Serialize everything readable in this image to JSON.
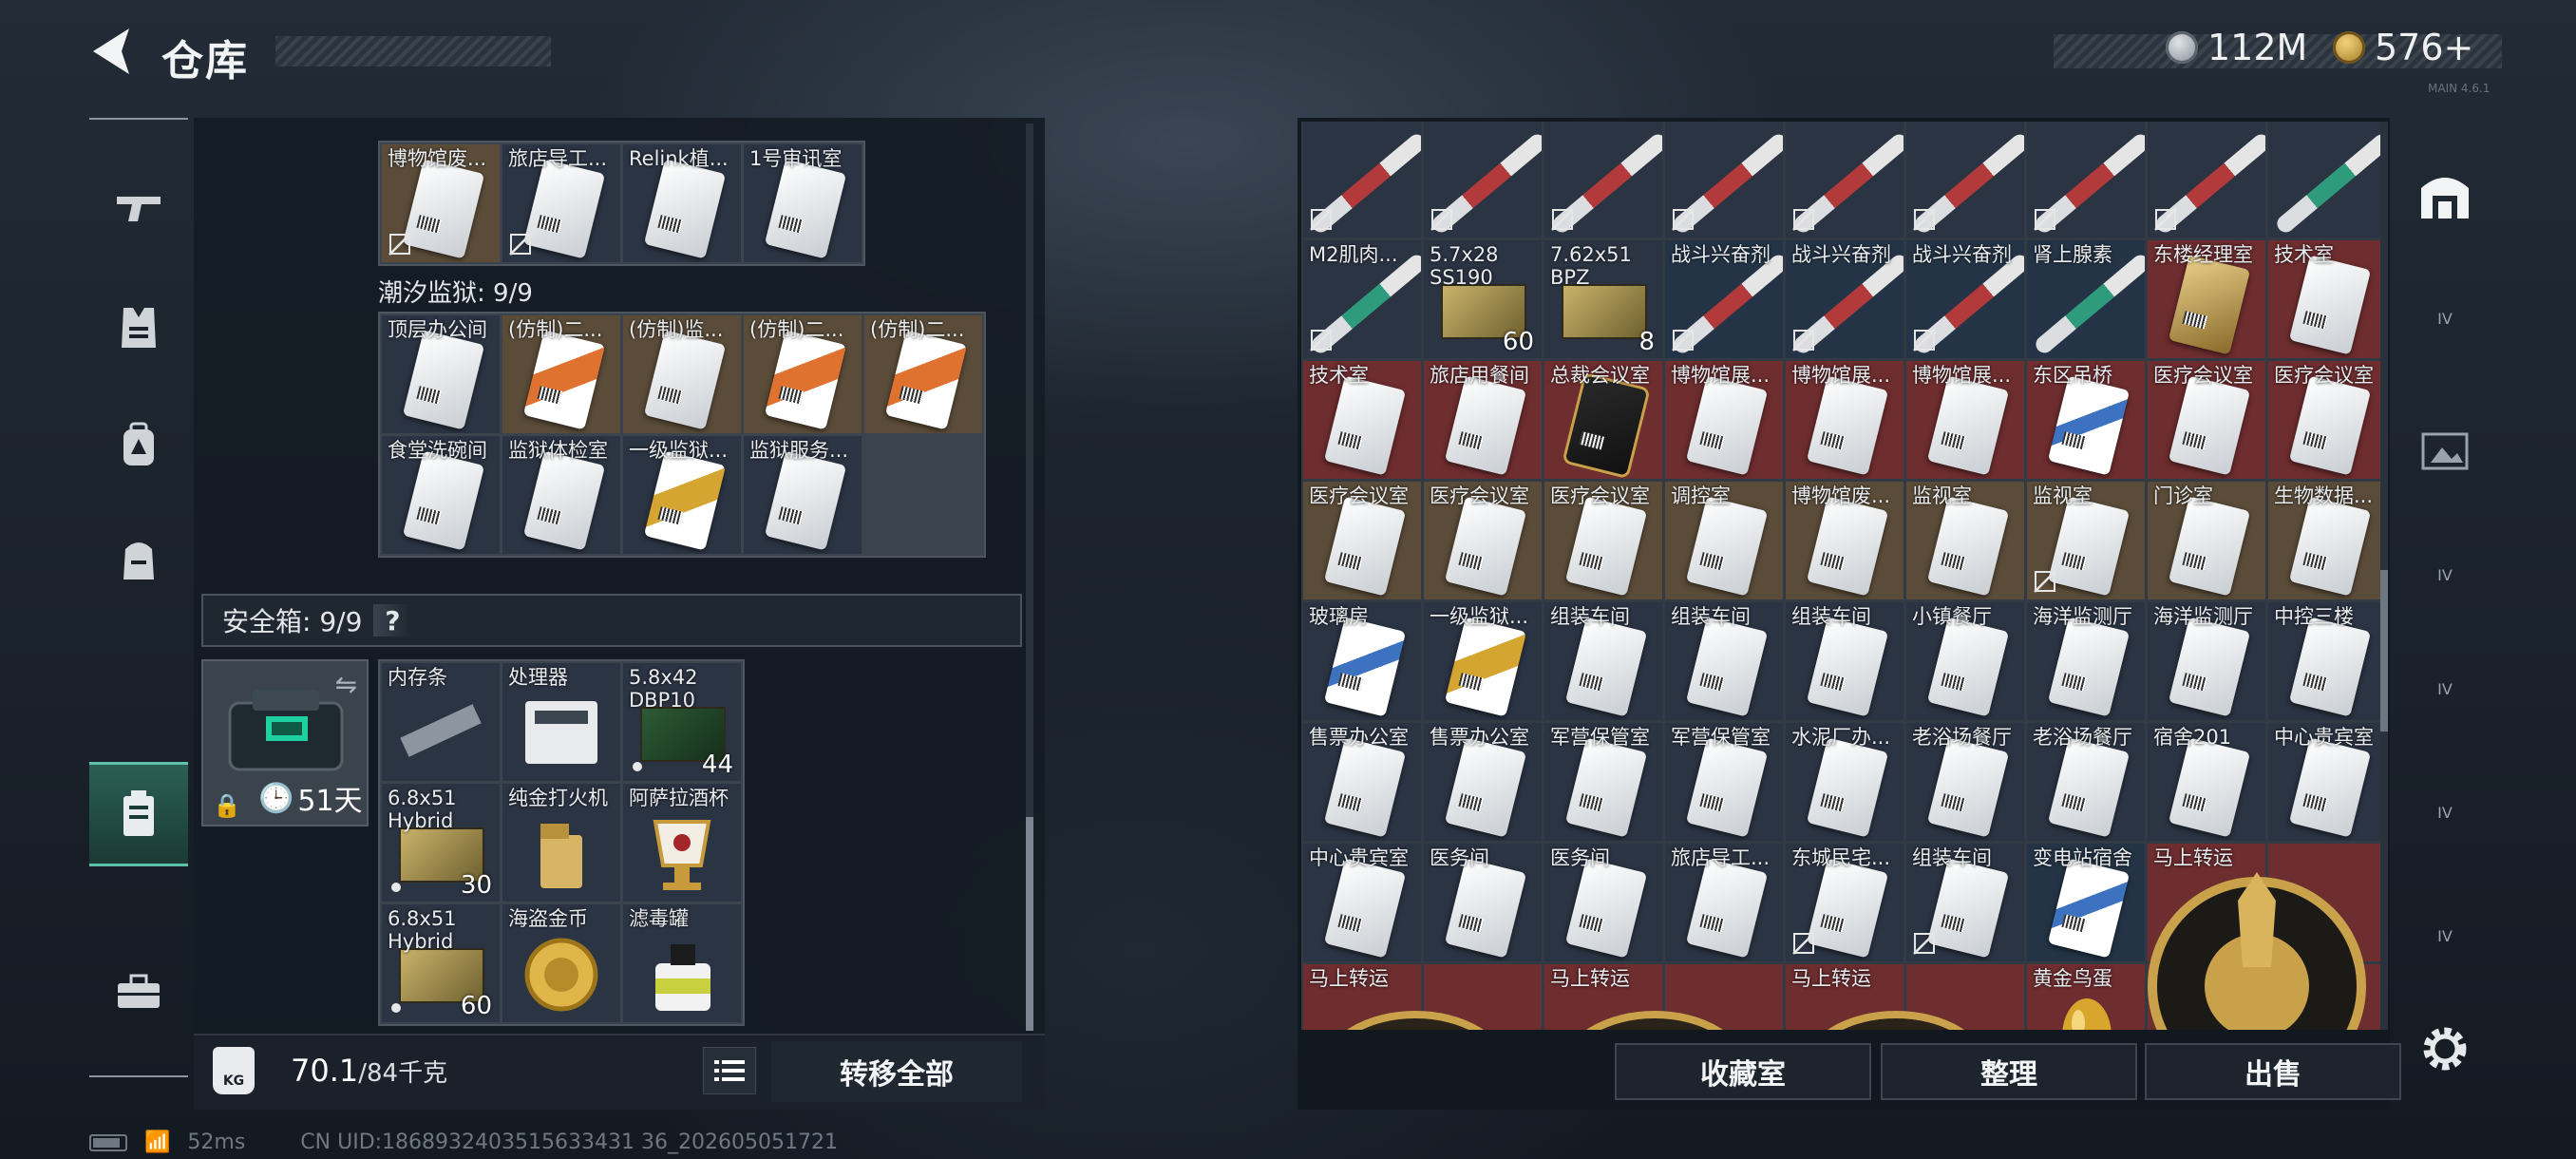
{
  "header": {
    "title": "仓库",
    "currency1": "112M",
    "currency2": "576+",
    "version": "MAIN 4.6.1"
  },
  "left": {
    "section_label": "潮汐监狱: 9/9",
    "grid_a": [
      {
        "label": "博物馆废...",
        "kind": "card",
        "bg": "gold",
        "nos": true
      },
      {
        "label": "旅店导工...",
        "kind": "card",
        "bg": "navy",
        "nos": true
      },
      {
        "label": "Relink植...",
        "kind": "card",
        "bg": "navy"
      },
      {
        "label": "1号审讯室",
        "kind": "card",
        "bg": "navy"
      }
    ],
    "grid_b": [
      {
        "label": "顶层办公间",
        "kind": "card",
        "bg": "navy"
      },
      {
        "label": "(仿制)二...",
        "kind": "card",
        "bg": "gold",
        "variant": "orange"
      },
      {
        "label": "(仿制)监...",
        "kind": "card",
        "bg": "gold"
      },
      {
        "label": "(仿制)二...",
        "kind": "card",
        "bg": "gold",
        "variant": "orange"
      },
      {
        "label": "(仿制)二...",
        "kind": "card",
        "bg": "gold",
        "variant": "orange"
      },
      {
        "label": "食堂洗碗间",
        "kind": "card",
        "bg": "navy"
      },
      {
        "label": "监狱体检室",
        "kind": "card",
        "bg": "navy"
      },
      {
        "label": "一级监狱...",
        "kind": "card",
        "bg": "navy",
        "variant": "gold"
      },
      {
        "label": "监狱服务...",
        "kind": "card",
        "bg": "navy"
      }
    ],
    "safe_label": "安全箱: 9/9",
    "safe_help": "?",
    "safe_days": "51天",
    "safe_grid": [
      {
        "label": "内存条",
        "kind": "ram",
        "bg": "slate"
      },
      {
        "label": "处理器",
        "kind": "cpu",
        "bg": "slate"
      },
      {
        "label": "5.8x42\nDBP10",
        "kind": "ammo",
        "bg": "slate",
        "variant": "g",
        "qty": "44",
        "dot": true
      },
      {
        "label": "6.8x51\nHybrid",
        "kind": "ammo",
        "bg": "slate",
        "qty": "30",
        "dot": true
      },
      {
        "label": "纯金打火机",
        "kind": "lighter",
        "bg": "slate"
      },
      {
        "label": "阿萨拉酒杯",
        "kind": "cup",
        "bg": "slate"
      },
      {
        "label": "6.8x51\nHybrid",
        "kind": "ammo",
        "bg": "slate",
        "qty": "60",
        "dot": true
      },
      {
        "label": "海盗金币",
        "kind": "coin",
        "bg": "slate"
      },
      {
        "label": "滤毒罐",
        "kind": "canister",
        "bg": "slate"
      }
    ],
    "weight_icon": "KG",
    "weight_value": "70.1",
    "weight_max": "/84千克",
    "transfer_label": "转移全部"
  },
  "right": {
    "grid": [
      {
        "label": "",
        "kind": "syringe",
        "bg": "navy",
        "nos": true
      },
      {
        "label": "",
        "kind": "syringe",
        "bg": "navy",
        "nos": true
      },
      {
        "label": "",
        "kind": "syringe",
        "bg": "navy",
        "nos": true
      },
      {
        "label": "",
        "kind": "syringe",
        "bg": "navy",
        "nos": true
      },
      {
        "label": "",
        "kind": "syringe",
        "bg": "navy",
        "nos": true
      },
      {
        "label": "",
        "kind": "syringe",
        "bg": "navy",
        "nos": true
      },
      {
        "label": "",
        "kind": "syringe",
        "bg": "navy",
        "nos": true
      },
      {
        "label": "",
        "kind": "syringe",
        "bg": "navy",
        "nos": true
      },
      {
        "label": "",
        "kind": "syringe",
        "bg": "navy",
        "variant": "g"
      },
      {
        "label": "M2肌肉...",
        "kind": "syringe",
        "bg": "navy",
        "variant": "g",
        "nos": true
      },
      {
        "label": "5.7x28\nSS190",
        "kind": "ammo",
        "bg": "navy",
        "qty": "60"
      },
      {
        "label": "7.62x51\nBPZ",
        "kind": "ammo",
        "bg": "navy",
        "qty": "8"
      },
      {
        "label": "战斗兴奋剂",
        "kind": "syringe",
        "bg": "blue",
        "nos": true
      },
      {
        "label": "战斗兴奋剂",
        "kind": "syringe",
        "bg": "blue",
        "nos": true
      },
      {
        "label": "战斗兴奋剂",
        "kind": "syringe",
        "bg": "blue",
        "nos": true
      },
      {
        "label": "肾上腺素",
        "kind": "syringe",
        "bg": "blue",
        "variant": "g"
      },
      {
        "label": "东楼经理室",
        "kind": "card",
        "bg": "red",
        "variant": "goldc"
      },
      {
        "label": "技术室",
        "kind": "card",
        "bg": "red"
      },
      {
        "label": "技术室",
        "kind": "card",
        "bg": "red"
      },
      {
        "label": "旅店用餐间",
        "kind": "card",
        "bg": "red"
      },
      {
        "label": "总裁会议室",
        "kind": "card",
        "bg": "red",
        "variant": "black"
      },
      {
        "label": "博物馆展...",
        "kind": "card",
        "bg": "red"
      },
      {
        "label": "博物馆展...",
        "kind": "card",
        "bg": "red"
      },
      {
        "label": "博物馆展...",
        "kind": "card",
        "bg": "red"
      },
      {
        "label": "东区吊桥",
        "kind": "card",
        "bg": "red",
        "variant": "blue"
      },
      {
        "label": "医疗会议室",
        "kind": "card",
        "bg": "red"
      },
      {
        "label": "医疗会议室",
        "kind": "card",
        "bg": "red"
      },
      {
        "label": "医疗会议室",
        "kind": "card",
        "bg": "gold"
      },
      {
        "label": "医疗会议室",
        "kind": "card",
        "bg": "gold"
      },
      {
        "label": "医疗会议室",
        "kind": "card",
        "bg": "gold"
      },
      {
        "label": "调控室",
        "kind": "card",
        "bg": "gold"
      },
      {
        "label": "博物馆废...",
        "kind": "card",
        "bg": "gold"
      },
      {
        "label": "监视室",
        "kind": "card",
        "bg": "gold"
      },
      {
        "label": "监视室",
        "kind": "card",
        "bg": "gold",
        "nos": true
      },
      {
        "label": "门诊室",
        "kind": "card",
        "bg": "gold"
      },
      {
        "label": "生物数据...",
        "kind": "card",
        "bg": "gold"
      },
      {
        "label": "玻璃房",
        "kind": "card",
        "bg": "navy",
        "variant": "blue"
      },
      {
        "label": "一级监狱...",
        "kind": "card",
        "bg": "navy",
        "variant": "gold"
      },
      {
        "label": "组装车间",
        "kind": "card",
        "bg": "navy"
      },
      {
        "label": "组装车间",
        "kind": "card",
        "bg": "navy"
      },
      {
        "label": "组装车间",
        "kind": "card",
        "bg": "navy"
      },
      {
        "label": "小镇餐厅",
        "kind": "card",
        "bg": "navy"
      },
      {
        "label": "海洋监测厅",
        "kind": "card",
        "bg": "navy"
      },
      {
        "label": "海洋监测厅",
        "kind": "card",
        "bg": "navy"
      },
      {
        "label": "中控三楼",
        "kind": "card",
        "bg": "navy"
      },
      {
        "label": "售票办公室",
        "kind": "card",
        "bg": "navy"
      },
      {
        "label": "售票办公室",
        "kind": "card",
        "bg": "navy"
      },
      {
        "label": "军营保管室",
        "kind": "card",
        "bg": "navy"
      },
      {
        "label": "军营保管室",
        "kind": "card",
        "bg": "navy"
      },
      {
        "label": "水泥厂办...",
        "kind": "card",
        "bg": "navy"
      },
      {
        "label": "老浴场餐厅",
        "kind": "card",
        "bg": "navy"
      },
      {
        "label": "老浴场餐厅",
        "kind": "card",
        "bg": "navy"
      },
      {
        "label": "宿舍201",
        "kind": "card",
        "bg": "navy"
      },
      {
        "label": "中心贵宾室",
        "kind": "card",
        "bg": "navy"
      },
      {
        "label": "中心贵宾室",
        "kind": "card",
        "bg": "navy"
      },
      {
        "label": "医务间",
        "kind": "card",
        "bg": "navy"
      },
      {
        "label": "医务间",
        "kind": "card",
        "bg": "navy"
      },
      {
        "label": "旅店导工...",
        "kind": "card",
        "bg": "navy"
      },
      {
        "label": "东城民宅...",
        "kind": "card",
        "bg": "navy",
        "nos": true
      },
      {
        "label": "组装车间",
        "kind": "card",
        "bg": "navy",
        "nos": true
      },
      {
        "label": "变电站宿舍",
        "kind": "card",
        "bg": "blue",
        "variant": "blue"
      },
      {
        "label": "马上转运",
        "kind": "none",
        "bg": "red"
      },
      {
        "label": "",
        "kind": "none",
        "bg": "red"
      },
      {
        "label": "马上转运",
        "kind": "none",
        "bg": "red"
      },
      {
        "label": "",
        "kind": "none",
        "bg": "red"
      },
      {
        "label": "马上转运",
        "kind": "none",
        "bg": "red"
      },
      {
        "label": "",
        "kind": "none",
        "bg": "red"
      },
      {
        "label": "马上转运",
        "kind": "none",
        "bg": "red"
      },
      {
        "label": "",
        "kind": "none",
        "bg": "red"
      },
      {
        "label": "黄金鸟蛋",
        "kind": "egg",
        "bg": "red"
      },
      {
        "label": "",
        "kind": "none",
        "bg": "red"
      },
      {
        "label": "",
        "kind": "none",
        "bg": "red"
      }
    ],
    "buttons": {
      "collection": "收藏室",
      "sort": "整理",
      "sell": "出售"
    }
  },
  "right_nav": [
    "IV",
    "IV",
    "IV",
    "IV",
    "IV"
  ],
  "status": {
    "ping": "52ms",
    "uid": "CN UID:1868932403515633431 36_202605051721"
  }
}
